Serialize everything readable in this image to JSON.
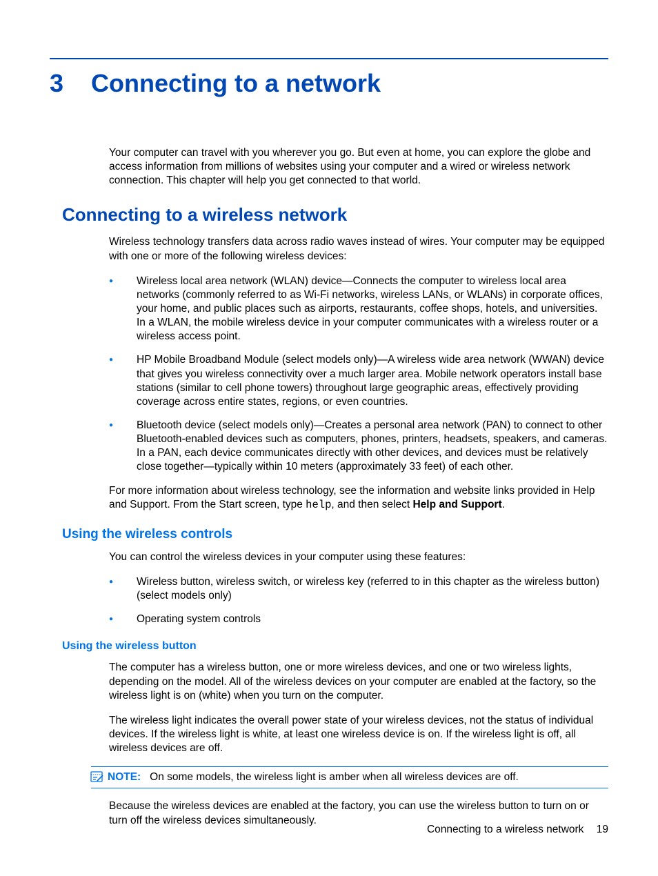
{
  "chapter": {
    "number": "3",
    "title": "Connecting to a network"
  },
  "intro": "Your computer can travel with you wherever you go. But even at home, you can explore the globe and access information from millions of websites using your computer and a wired or wireless network connection. This chapter will help you get connected to that world.",
  "section1": {
    "title": "Connecting to a wireless network",
    "intro": "Wireless technology transfers data across radio waves instead of wires. Your computer may be equipped with one or more of the following wireless devices:",
    "bullets": [
      "Wireless local area network (WLAN) device—Connects the computer to wireless local area networks (commonly referred to as Wi-Fi networks, wireless LANs, or WLANs) in corporate offices, your home, and public places such as airports, restaurants, coffee shops, hotels, and universities. In a WLAN, the mobile wireless device in your computer communicates with a wireless router or a wireless access point.",
      "HP Mobile Broadband Module (select models only)—A wireless wide area network (WWAN) device that gives you wireless connectivity over a much larger area. Mobile network operators install base stations (similar to cell phone towers) throughout large geographic areas, effectively providing coverage across entire states, regions, or even countries.",
      "Bluetooth device (select models only)—Creates a personal area network (PAN) to connect to other Bluetooth-enabled devices such as computers, phones, printers, headsets, speakers, and cameras. In a PAN, each device communicates directly with other devices, and devices must be relatively close together—typically within 10 meters (approximately 33 feet) of each other."
    ],
    "outro_prefix": "For more information about wireless technology, see the information and website links provided in Help and Support. From the Start screen, type ",
    "outro_code": "help",
    "outro_mid": ", and then select ",
    "outro_bold": "Help and Support",
    "outro_suffix": "."
  },
  "section2": {
    "title": "Using the wireless controls",
    "intro": "You can control the wireless devices in your computer using these features:",
    "bullets": [
      "Wireless button, wireless switch, or wireless key (referred to in this chapter as the wireless button) (select models only)",
      "Operating system controls"
    ]
  },
  "section3": {
    "title": "Using the wireless button",
    "p1": "The computer has a wireless button, one or more wireless devices, and one or two wireless lights, depending on the model. All of the wireless devices on your computer are enabled at the factory, so the wireless light is on (white) when you turn on the computer.",
    "p2": "The wireless light indicates the overall power state of your wireless devices, not the status of individual devices. If the wireless light is white, at least one wireless device is on. If the wireless light is off, all wireless devices are off.",
    "note_label": "NOTE:",
    "note_text": "On some models, the wireless light is amber when all wireless devices are off.",
    "p3": "Because the wireless devices are enabled at the factory, you can use the wireless button to turn on or turn off the wireless devices simultaneously."
  },
  "footer": {
    "section": "Connecting to a wireless network",
    "page": "19"
  }
}
